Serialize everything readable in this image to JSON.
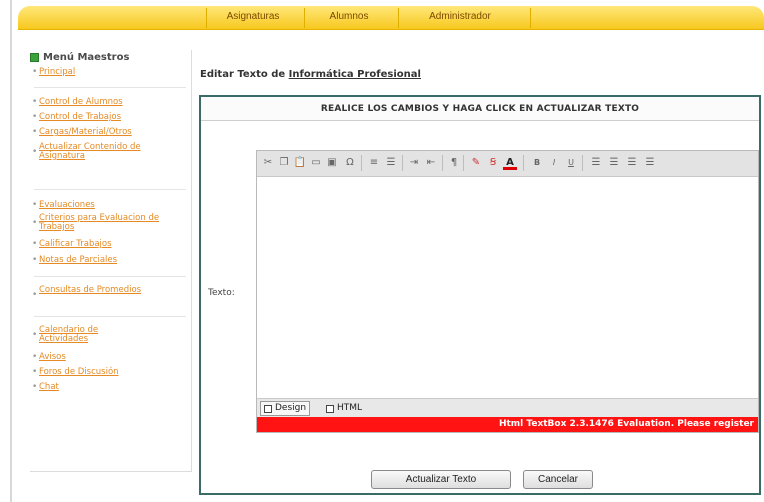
{
  "topnav": {
    "tabs": [
      {
        "label": "Asignaturas"
      },
      {
        "label": "Alumnos"
      },
      {
        "label": "Administrador"
      }
    ]
  },
  "sidebar": {
    "title": "Menú Maestros",
    "items": [
      {
        "label": "Principal"
      },
      {
        "label": "Control de Alumnos"
      },
      {
        "label": "Control de Trabajos"
      },
      {
        "label": "Cargas/Material/Otros"
      },
      {
        "label": "Actualizar Contenido de Asignatura"
      },
      {
        "label": "Evaluaciones"
      },
      {
        "label": "Criterios para Evaluacion de Trabajos"
      },
      {
        "label": "Calificar Trabajos"
      },
      {
        "label": "Notas de Parciales"
      },
      {
        "label": "Consultas de Promedios"
      },
      {
        "label": "Calendario de Actividades"
      },
      {
        "label": "Avisos"
      },
      {
        "label": "Foros de Discusión"
      },
      {
        "label": "Chat"
      }
    ]
  },
  "main": {
    "edit_prefix": "Editar Texto de",
    "subject": "Informática Profesional",
    "panel_header": "REALICE LOS CAMBIOS Y HAGA CLICK EN ACTUALIZAR TEXTO",
    "texto_label": "Texto:",
    "editor": {
      "mode_design": "Design",
      "mode_html": "HTML",
      "eval_text": "Html TextBox 2.3.1476 Evaluation. Please register",
      "toolbar_icons": [
        "cut-icon",
        "copy-icon",
        "paste-icon",
        "table-icon",
        "image-icon",
        "special-char-icon",
        "ordered-list-icon",
        "unordered-list-icon",
        "indent-icon",
        "outdent-icon",
        "paragraph-icon",
        "font-color-icon",
        "highlight-icon",
        "text-color-icon",
        "bold-icon",
        "italic-icon",
        "underline-icon",
        "align-left-icon",
        "align-center-icon",
        "align-right-icon",
        "justify-icon"
      ]
    },
    "buttons": {
      "update": "Actualizar Texto",
      "cancel": "Cancelar"
    }
  },
  "colors": {
    "nav_yellow": "#f7c81e",
    "link_orange": "#e58a24",
    "panel_border": "#3a6b66",
    "eval_red": "#ff1313"
  }
}
